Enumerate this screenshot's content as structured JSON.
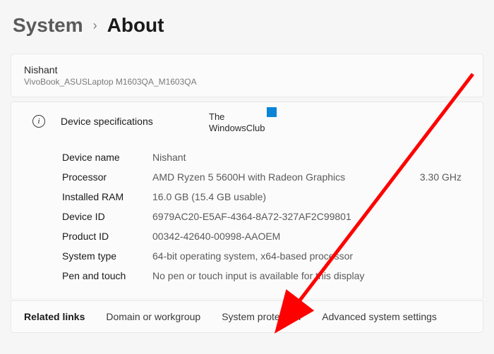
{
  "breadcrumb": {
    "parent": "System",
    "current": "About"
  },
  "user": {
    "name": "Nishant",
    "model": "VivoBook_ASUSLaptop M1603QA_M1603QA"
  },
  "section": {
    "title": "Device specifications"
  },
  "specs": {
    "device_name": {
      "label": "Device name",
      "value": "Nishant"
    },
    "processor": {
      "label": "Processor",
      "value": "AMD Ryzen 5 5600H with Radeon Graphics",
      "extra": "3.30 GHz"
    },
    "ram": {
      "label": "Installed RAM",
      "value": "16.0 GB (15.4 GB usable)"
    },
    "device_id": {
      "label": "Device ID",
      "value": "6979AC20-E5AF-4364-8A72-327AF2C99801"
    },
    "product_id": {
      "label": "Product ID",
      "value": "00342-42640-00998-AAOEM"
    },
    "system_type": {
      "label": "System type",
      "value": "64-bit operating system, x64-based processor"
    },
    "pen_touch": {
      "label": "Pen and touch",
      "value": "No pen or touch input is available for this display"
    }
  },
  "related": {
    "title": "Related links",
    "links": {
      "domain": "Domain or workgroup",
      "protection": "System protection",
      "advanced": "Advanced system settings"
    }
  },
  "watermark": {
    "line1": "The",
    "line2": "WindowsClub"
  }
}
